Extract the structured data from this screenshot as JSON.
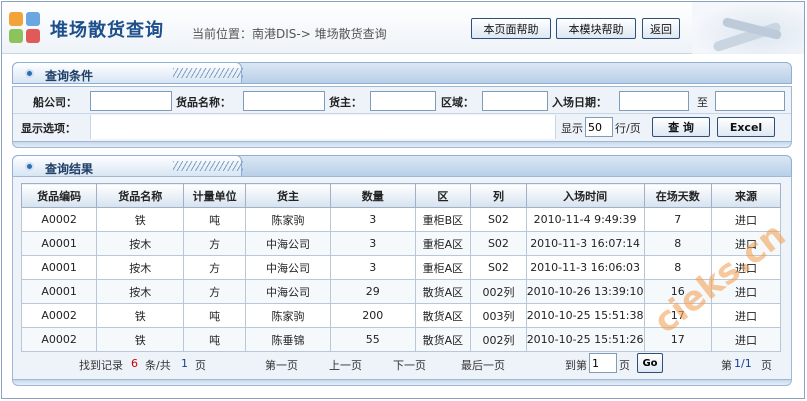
{
  "header": {
    "app_title": "堆场散货查询",
    "breadcrumb": "当前位置：南港DIS-> 堆场散货查询",
    "help_page_label": "本页面帮助",
    "help_module_label": "本模块帮助",
    "back_label": "返回"
  },
  "query_panel": {
    "title": "查询条件",
    "fields": {
      "shipping_company": {
        "label": "船公司：",
        "value": ""
      },
      "goods_name": {
        "label": "货品名称：",
        "value": ""
      },
      "owner": {
        "label": "货主：",
        "value": ""
      },
      "area": {
        "label": "区域：",
        "value": ""
      },
      "entry_date": {
        "label": "入场日期：",
        "from": "",
        "to_label": "至",
        "to": ""
      }
    },
    "display_options_label": "显示选项：",
    "page_size_prefix": "显示",
    "page_size_value": "50",
    "page_size_suffix": "行/页",
    "query_button": "查 询",
    "excel_button": "Excel"
  },
  "results_panel": {
    "title": "查询结果",
    "columns": [
      "货品编码",
      "货品名称",
      "计量单位",
      "货主",
      "数量",
      "区",
      "列",
      "入场时间",
      "在场天数",
      "来源"
    ],
    "rows": [
      [
        "A0002",
        "铁",
        "吨",
        "陈家驹",
        "3",
        "重柜B区",
        "S02",
        "2010-11-4 9:49:39",
        "7",
        "进口"
      ],
      [
        "A0001",
        "按木",
        "方",
        "中海公司",
        "3",
        "重柜A区",
        "S02",
        "2010-11-3 16:07:14",
        "8",
        "进口"
      ],
      [
        "A0001",
        "按木",
        "方",
        "中海公司",
        "3",
        "重柜A区",
        "S02",
        "2010-11-3 16:06:03",
        "8",
        "进口"
      ],
      [
        "A0001",
        "按木",
        "方",
        "中海公司",
        "29",
        "散货A区",
        "002列",
        "2010-10-26 13:39:10",
        "16",
        "进口"
      ],
      [
        "A0002",
        "铁",
        "吨",
        "陈家驹",
        "200",
        "散货A区",
        "003列",
        "2010-10-25 15:51:38",
        "17",
        "进口"
      ],
      [
        "A0002",
        "铁",
        "吨",
        "陈垂锦",
        "55",
        "散货A区",
        "002列",
        "2010-10-25 15:51:26",
        "17",
        "进口"
      ]
    ]
  },
  "pager": {
    "found_prefix": "找到记录",
    "record_count": "6",
    "found_mid": "条/共",
    "page_total": "1",
    "found_suffix": "页",
    "first": "第一页",
    "prev": "上一页",
    "next": "下一页",
    "last": "最后一页",
    "goto_prefix": "到第",
    "goto_value": "1",
    "goto_suffix": "页",
    "go_button": "Go",
    "current_prefix": "第",
    "current_page": "1/1",
    "current_suffix": "页"
  },
  "watermark": "cieks.cn"
}
